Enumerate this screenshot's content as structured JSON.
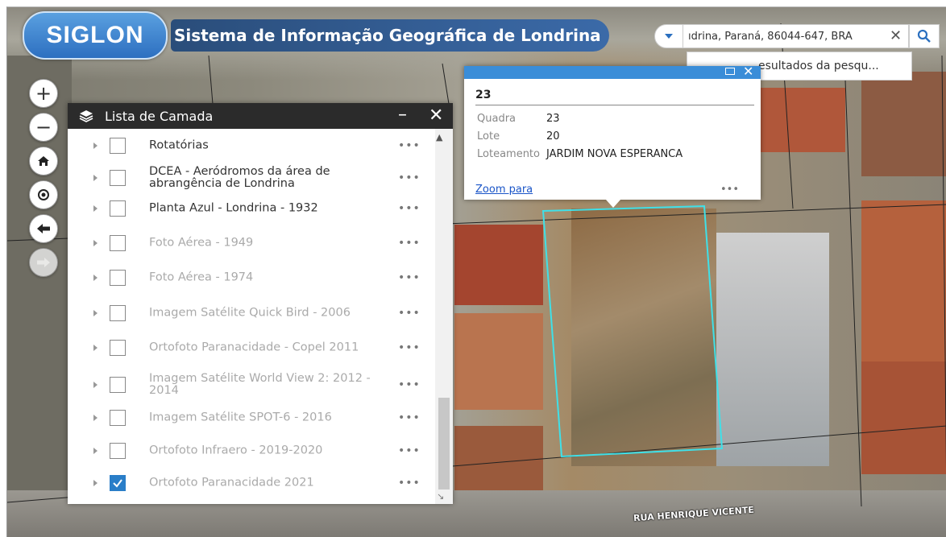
{
  "header": {
    "logo_text": "SIGLON",
    "app_title": "Sistema de Informação Geográfica de Londrina"
  },
  "search": {
    "value": "ıdrina, Paraná, 86044-647, BRA",
    "clear_glyph": "✕",
    "results_label": "esultados da pesqu..."
  },
  "map_tools": {
    "zoom_in": "+",
    "zoom_out": "−"
  },
  "layer_list": {
    "title": "Lista de Camada",
    "minimize": "–",
    "close": "✕",
    "items": [
      {
        "label": "Rotatórias",
        "checked": false,
        "dim": false
      },
      {
        "label": "DCEA - Aeródromos da área de abrangência de Londrina",
        "checked": false,
        "dim": false
      },
      {
        "label": "Planta Azul - Londrina - 1932",
        "checked": false,
        "dim": false
      },
      {
        "label": "Foto Aérea - 1949",
        "checked": false,
        "dim": true
      },
      {
        "label": "Foto Aérea - 1974",
        "checked": false,
        "dim": true
      },
      {
        "label": "Imagem Satélite Quick Bird - 2006",
        "checked": false,
        "dim": true
      },
      {
        "label": "Ortofoto Paranacidade - Copel 2011",
        "checked": false,
        "dim": true
      },
      {
        "label": "Imagem Satélite World View 2: 2012 - 2014",
        "checked": false,
        "dim": true
      },
      {
        "label": "Imagem Satélite SPOT-6 - 2016",
        "checked": false,
        "dim": true
      },
      {
        "label": "Ortofoto Infraero - 2019-2020",
        "checked": false,
        "dim": true
      },
      {
        "label": "Ortofoto Paranacidade 2021",
        "checked": true,
        "dim": true
      }
    ],
    "more_glyph": "•••"
  },
  "popup": {
    "title": "23",
    "fields": [
      {
        "key": "Quadra",
        "value": "23"
      },
      {
        "key": "Lote",
        "value": "20"
      },
      {
        "key": "Loteamento",
        "value": "JARDIM NOVA ESPERANCA"
      }
    ],
    "zoom_label": "Zoom para",
    "more_glyph": "•••"
  },
  "map": {
    "street_label": "RUA HENRIQUE VICENTE",
    "parcel_color": "#3fe0e8"
  }
}
